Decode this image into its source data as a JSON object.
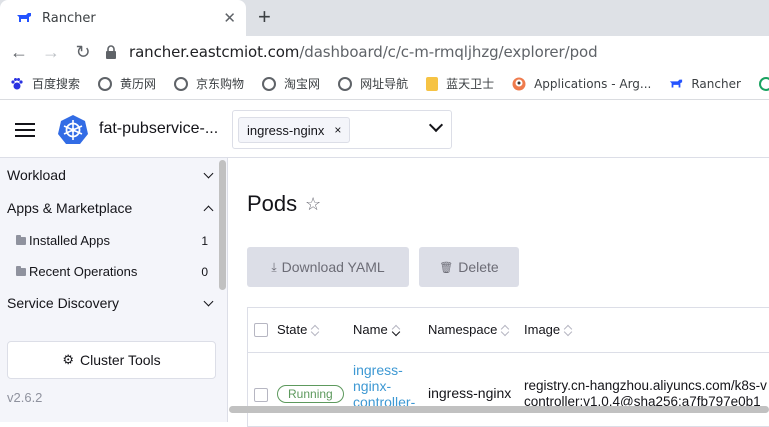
{
  "browser": {
    "tab_title": "Rancher",
    "url_host": "rancher.eastcmiot.com",
    "url_path": "/dashboard/c/c-m-rmqljhzg/explorer/pod",
    "new_tab_label": "+",
    "tab_close": "✕"
  },
  "bookmarks": [
    {
      "label": "百度搜索",
      "icon": "globe-icon"
    },
    {
      "label": "黄历网",
      "icon": "globe-icon"
    },
    {
      "label": "京东购物",
      "icon": "globe-icon"
    },
    {
      "label": "淘宝网",
      "icon": "globe-icon"
    },
    {
      "label": "网址导航",
      "icon": "globe-icon"
    },
    {
      "label": "蓝天卫士",
      "icon": "folder-icon"
    },
    {
      "label": "Applications - Arg...",
      "icon": "argo-icon"
    },
    {
      "label": "Rancher",
      "icon": "rancher-icon"
    }
  ],
  "header": {
    "cluster_name": "fat-pubservice-...",
    "namespace_chip": "ingress-nginx",
    "chip_remove": "×"
  },
  "sidebar": {
    "workload": "Workload",
    "apps": "Apps & Marketplace",
    "installed_apps": "Installed Apps",
    "installed_apps_count": "1",
    "recent_operations": "Recent Operations",
    "recent_operations_count": "0",
    "service_discovery": "Service Discovery",
    "cluster_tools": "Cluster Tools",
    "version": "v2.6.2"
  },
  "main": {
    "title": "Pods",
    "star": "☆",
    "download_yaml": "Download YAML",
    "delete": "Delete",
    "columns": [
      "State",
      "Name",
      "Namespace",
      "Image"
    ],
    "row": {
      "state": "Running",
      "name": "ingress-nginx-controller-",
      "namespace": "ingress-nginx",
      "image_line1": "registry.cn-hangzhou.aliyuncs.com/k8s-v",
      "image_line2": "controller:v1.0.4@sha256:a7fb797e0b1"
    }
  },
  "colors": {
    "accent": "#3d98d3",
    "running": "#5d995d",
    "sidebar_bg": "#f4f5fa",
    "button_bg": "#dcdee7"
  }
}
